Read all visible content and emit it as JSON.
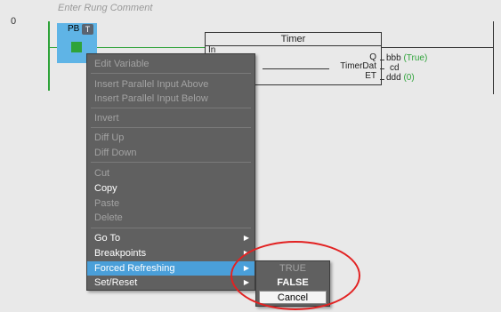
{
  "rung": {
    "number": "0",
    "comment_placeholder": "Enter Rung Comment"
  },
  "contact": {
    "label": "PB",
    "forced_icon": "forced-refresh-icon"
  },
  "timer": {
    "title": "Timer",
    "input_pin": "In",
    "pins": {
      "q": "Q",
      "timer_dat": "TimerDat",
      "et": "ET"
    },
    "outputs": {
      "q_var": "bbb",
      "q_value": "(True)",
      "timer_dat_var": "cd",
      "et_var": "ddd",
      "et_value": "(0)"
    }
  },
  "context_menu": {
    "edit_variable": "Edit Variable",
    "insert_parallel_above": "Insert Parallel Input Above",
    "insert_parallel_below": "Insert Parallel Input Below",
    "invert": "Invert",
    "diff_up": "Diff Up",
    "diff_down": "Diff Down",
    "cut": "Cut",
    "copy": "Copy",
    "paste": "Paste",
    "delete": "Delete",
    "go_to": "Go To",
    "breakpoints": "Breakpoints",
    "forced_refreshing": "Forced Refreshing",
    "set_reset": "Set/Reset",
    "submenu_arrow": "▶"
  },
  "forced_submenu": {
    "true": "TRUE",
    "false": "FALSE",
    "cancel": "Cancel"
  },
  "colors": {
    "highlight": "#4a9fd9",
    "contact_selection": "#5fb4e6",
    "energized": "#2fa33a",
    "annotation": "#e22222",
    "menu_bg": "#606060"
  }
}
